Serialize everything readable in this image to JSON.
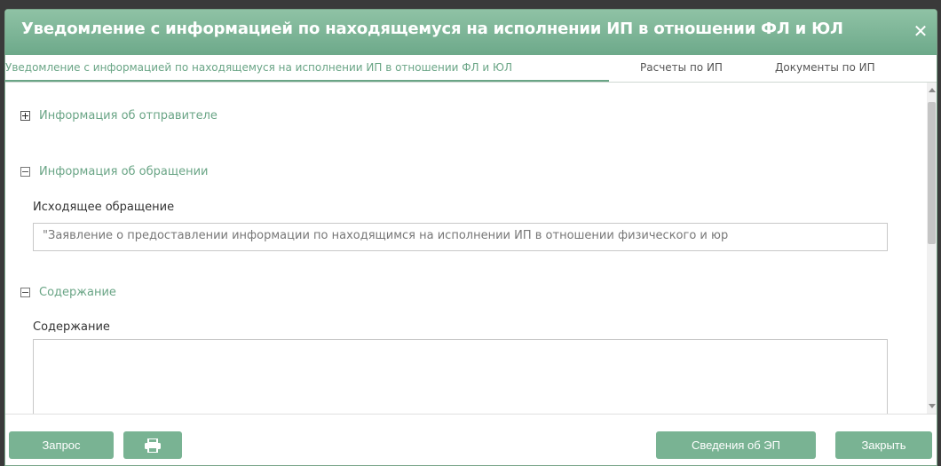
{
  "dialog": {
    "title": "Уведомление с информацией по находящемуся на исполнении ИП в отношении ФЛ и ЮЛ",
    "close_icon": "close-icon"
  },
  "tabs": [
    {
      "label": "Уведомление с информацией по находящемуся на исполнении ИП в отношении ФЛ и ЮЛ",
      "active": true
    },
    {
      "label": "Расчеты по ИП",
      "active": false
    },
    {
      "label": "Документы по ИП",
      "active": false
    }
  ],
  "sections": {
    "sender": {
      "title": "Информация об отправителе",
      "expanded": false
    },
    "request": {
      "title": "Информация об обращении",
      "expanded": true,
      "outgoing_label": "Исходящее обращение",
      "outgoing_value": "\"Заявление о предоставлении информации по находящимся на исполнении ИП в отношении физического и юр"
    },
    "content": {
      "title": "Содержание",
      "expanded": true,
      "content_label": "Содержание",
      "content_value": ""
    }
  },
  "footer": {
    "request_button": "Запрос",
    "print_icon": "printer-icon",
    "ep_button": "Сведения об ЭП",
    "close_button": "Закрыть"
  },
  "colors": {
    "accent": "#79b393",
    "title_bar": "#6da98a",
    "link_text": "#6aa586"
  }
}
